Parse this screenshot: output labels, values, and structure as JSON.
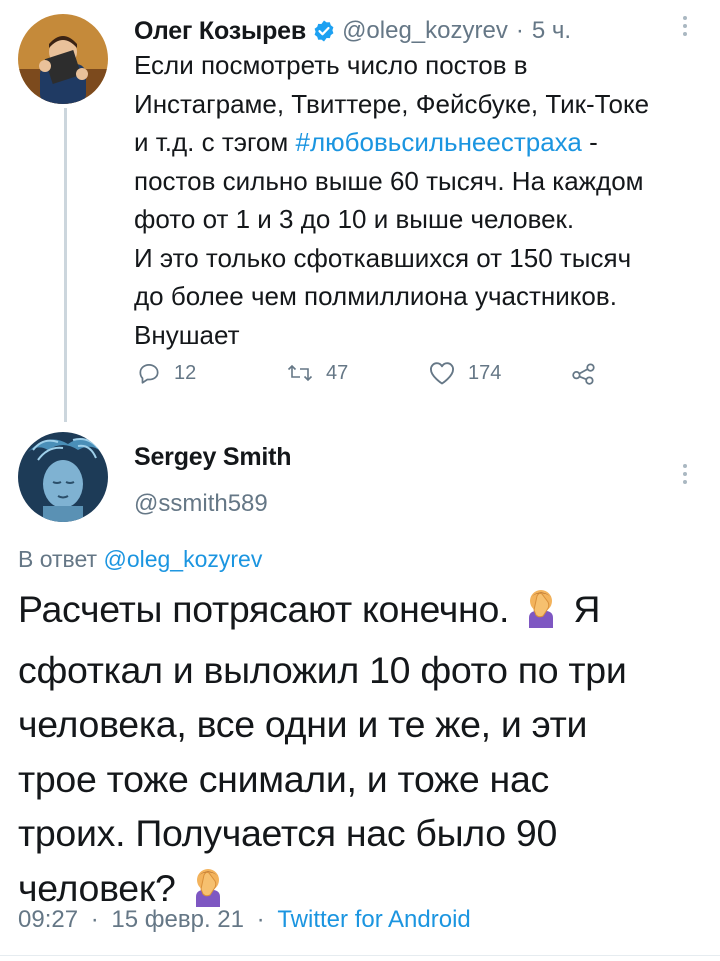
{
  "original_tweet": {
    "author_name": "Олег Козырев",
    "author_handle": "@oleg_kozyrev",
    "time_sep": "·",
    "time_ago": "5 ч.",
    "text_line1": "Если посмотреть число постов в",
    "text_line2": "Инстаграме, Твиттере, Фейсбуке, Тик-Токе",
    "text_line3_pre": "и т.д. с тэгом ",
    "hashtag": "#любовьсильнеестраха",
    "text_line3_post": " -",
    "text_line4": "постов сильно выше 60 тысяч. На каждом",
    "text_line5": "фото от 1 и 3 до 10 и выше человек.",
    "text_line6": "И это только сфоткавшихся от 150 тысяч",
    "text_line7": "до более чем полмиллиона участников.",
    "text_line8": "Внушает",
    "replies": "12",
    "retweets": "47",
    "likes": "174"
  },
  "reply_tweet": {
    "author_name": "Sergey Smith",
    "author_handle": "@ssmith589",
    "in_reply_prefix": "В ответ ",
    "in_reply_handle": "@oleg_kozyrev",
    "line1_pre": "Расчеты потрясают конечно.",
    "line1_post": "Я",
    "line2": "сфоткал и выложил 10 фото по три",
    "line3": "человека, все одни и те же, и эти",
    "line4": "трое тоже снимали, и тоже нас",
    "line5": "троих. Получается нас было 90",
    "line6_pre": "человек?",
    "emoji_1": "facepalm-emoji",
    "emoji_2": "facepalm-emoji",
    "time": "09:27",
    "sep1": "·",
    "date": "15 февр. 21",
    "sep2": "·",
    "client": "Twitter for Android"
  },
  "colors": {
    "link": "#1b95e0",
    "muted": "#657786",
    "verified": "#1da1f2",
    "divider": "#e6ecf0"
  }
}
